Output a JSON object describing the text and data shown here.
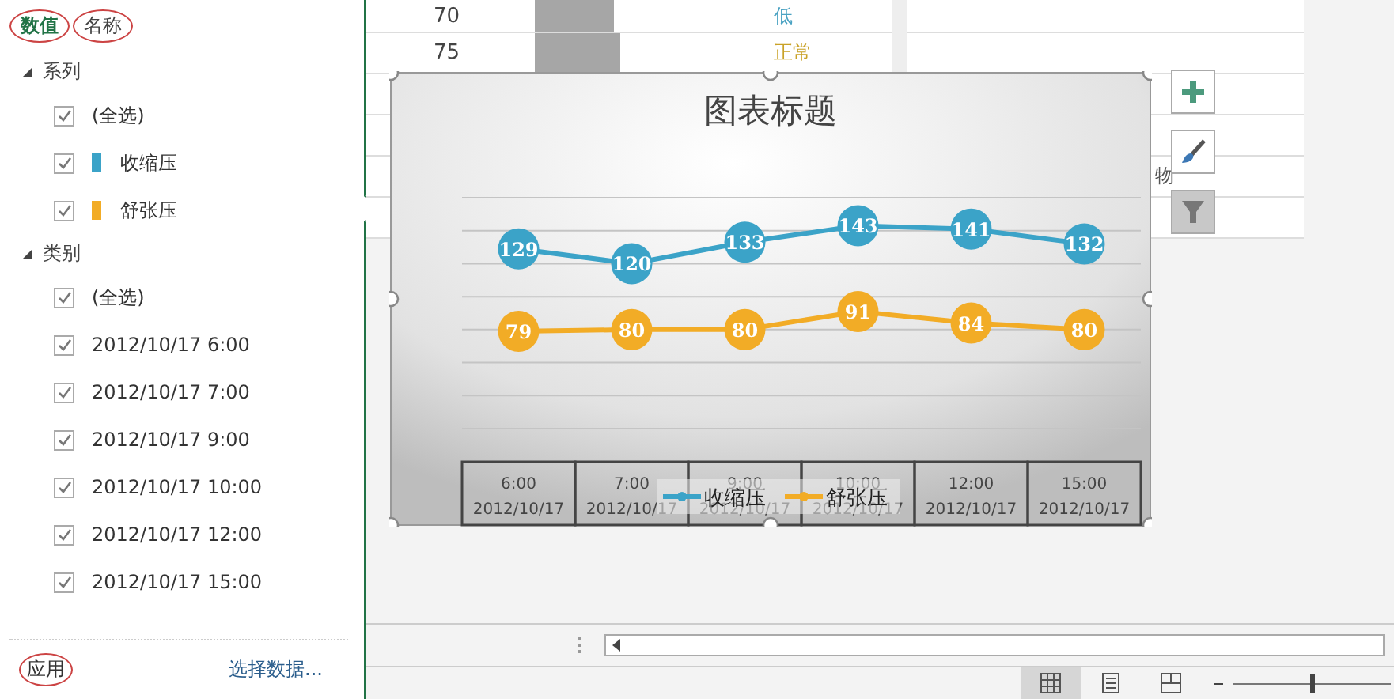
{
  "filter_pane": {
    "tabs": [
      {
        "label": "数值",
        "selected": true
      },
      {
        "label": "名称",
        "selected": false
      }
    ],
    "groups": [
      {
        "label": "系列",
        "expanded": true,
        "children": [
          {
            "label": "(全选)",
            "checked": true
          },
          {
            "label": "收缩压",
            "checked": true,
            "color": "#3ba3c8"
          },
          {
            "label": "舒张压",
            "checked": true,
            "color": "#f2ac26"
          }
        ]
      },
      {
        "label": "类别",
        "expanded": true,
        "children": [
          {
            "label": "(全选)",
            "checked": true
          },
          {
            "label": "2012/10/17 6:00",
            "checked": true
          },
          {
            "label": "2012/10/17 7:00",
            "checked": true
          },
          {
            "label": "2012/10/17 9:00",
            "checked": true
          },
          {
            "label": "2012/10/17 10:00",
            "checked": true
          },
          {
            "label": "2012/10/17 12:00",
            "checked": true
          },
          {
            "label": "2012/10/17 15:00",
            "checked": true
          }
        ]
      }
    ],
    "apply_button": "应用",
    "select_data_link": "选择数据..."
  },
  "sheet": {
    "rows": [
      {
        "value": "70",
        "status": "低",
        "color": "#4ba3c3"
      },
      {
        "value": "75",
        "status": "正常",
        "color": "#c9a227"
      }
    ],
    "cut_text": "物"
  },
  "chart": {
    "chart_data": {
      "type": "line",
      "title": "图表标题",
      "categories": [
        "6:00\n2012/10/17",
        "7:00\n2012/10/17",
        "9:00\n2012/10/17",
        "10:00\n2012/10/17",
        "12:00\n2012/10/17",
        "15:00\n2012/10/17"
      ],
      "ylim": [
        20,
        160
      ],
      "data_labels": true,
      "legend": true,
      "series": [
        {
          "name": "收缩压",
          "color": "#3ba3c8",
          "marker": "circle",
          "values": [
            129,
            120,
            133,
            143,
            141,
            132
          ]
        },
        {
          "name": "舒张压",
          "color": "#f2ac26",
          "marker": "circle",
          "values": [
            79,
            80,
            80,
            91,
            84,
            80
          ]
        }
      ]
    }
  },
  "chart_buttons": [
    {
      "kind": "add",
      "selected": false
    },
    {
      "kind": "style",
      "selected": false
    },
    {
      "kind": "filter",
      "selected": true
    }
  ],
  "status_bar": {
    "views": [
      {
        "kind": "normal",
        "selected": true
      },
      {
        "kind": "page_layout",
        "selected": false
      },
      {
        "kind": "page_break",
        "selected": false
      }
    ],
    "zoom": {
      "level": 0.5
    }
  }
}
